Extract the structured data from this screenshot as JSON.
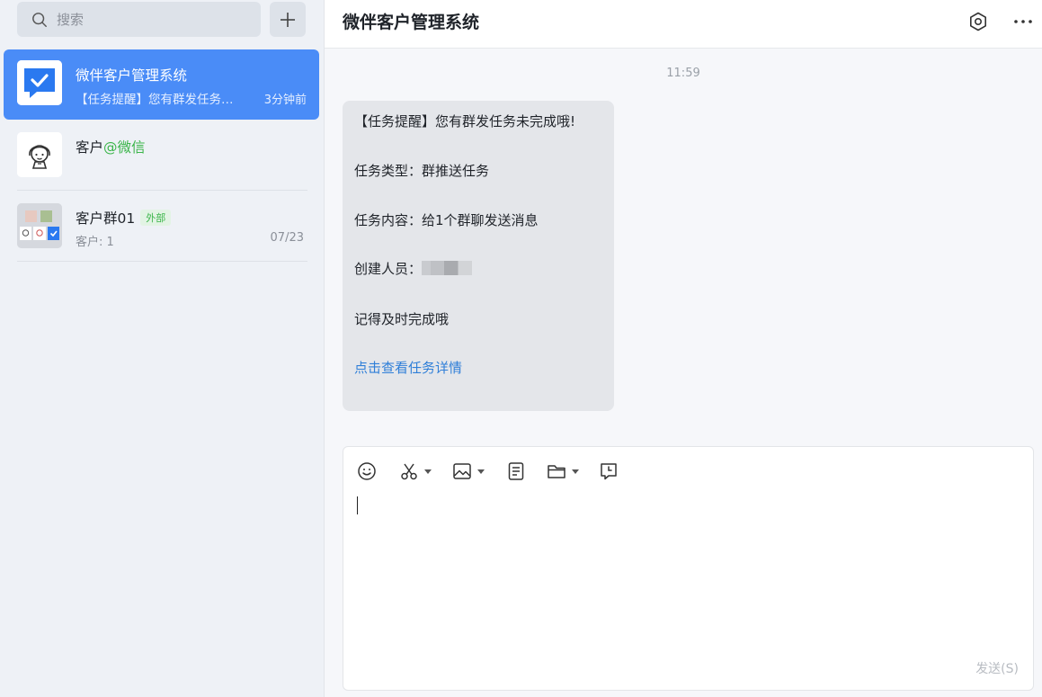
{
  "search": {
    "placeholder": "搜索"
  },
  "conversations": [
    {
      "name": "微伴客户管理系统",
      "preview": "【任务提醒】您有群发任务…",
      "time": "3分钟前"
    },
    {
      "name": "客户",
      "tag": "@微信"
    },
    {
      "name": "客户群01",
      "tag": "外部",
      "sub": "客户: 1",
      "time": "07/23"
    }
  ],
  "header": {
    "title": "微伴客户管理系统"
  },
  "messages": {
    "time": "11:59",
    "lines": [
      "【任务提醒】您有群发任务未完成哦!",
      "任务类型：群推送任务",
      "任务内容：给1个群聊发送消息",
      "创建人员：",
      "记得及时完成哦",
      "点击查看任务详情"
    ]
  },
  "editor": {
    "send_label": "发送(S)"
  },
  "colors": {
    "accent": "#4a8cf7",
    "link": "#2f7fd8",
    "external_tag": "#3bb54a"
  },
  "icons": [
    "search-icon",
    "plus-icon",
    "settings-icon",
    "more-icon",
    "emoji-icon",
    "scissors-icon",
    "image-icon",
    "document-icon",
    "folder-icon",
    "clock-message-icon"
  ]
}
